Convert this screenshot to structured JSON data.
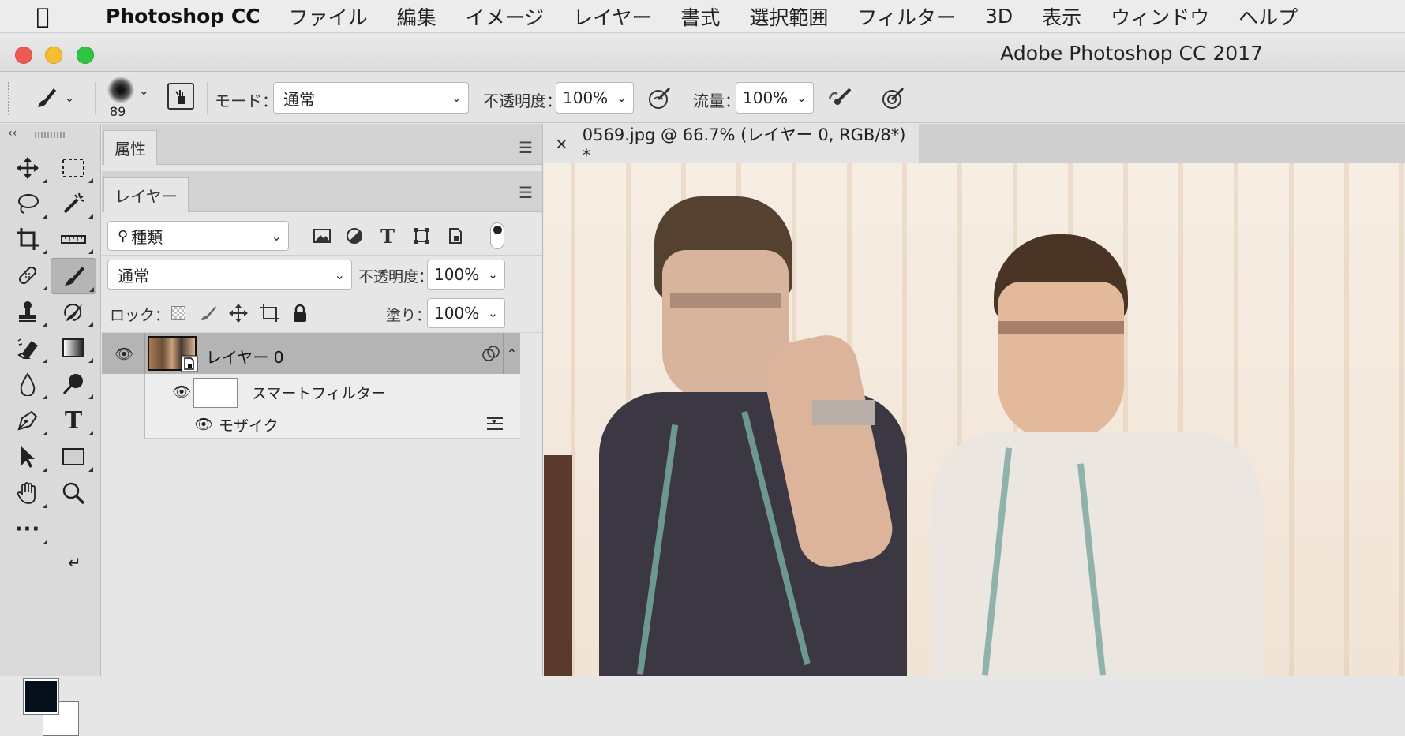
{
  "menubar": {
    "app": "Photoshop CC",
    "items": [
      "ファイル",
      "編集",
      "イメージ",
      "レイヤー",
      "書式",
      "選択範囲",
      "フィルター",
      "3D",
      "表示",
      "ウィンドウ",
      "ヘルプ"
    ]
  },
  "window": {
    "title": "Adobe Photoshop CC 2017"
  },
  "options": {
    "brush_size": "89",
    "mode_label": "モード：",
    "mode_value": "通常",
    "opacity_label": "不透明度：",
    "opacity_value": "100%",
    "flow_label": "流量：",
    "flow_value": "100%"
  },
  "panels": {
    "properties_tab": "属性",
    "layers_tab": "レイヤー",
    "filter_kind": "種類",
    "blend_mode": "通常",
    "opacity_label": "不透明度：",
    "opacity_value": "100%",
    "lock_label": "ロック：",
    "fill_label": "塗り：",
    "fill_value": "100%",
    "layers": [
      {
        "name": "レイヤー 0",
        "visible": true,
        "selected": true
      },
      {
        "name": "スマートフィルター",
        "visible": true
      },
      {
        "name": "モザイク",
        "visible": true
      }
    ]
  },
  "document": {
    "tab_title": "0569.jpg @ 66.7% (レイヤー 0, RGB/8*) *"
  },
  "colors": {
    "foreground": "#06101a",
    "background": "#ffffff"
  }
}
